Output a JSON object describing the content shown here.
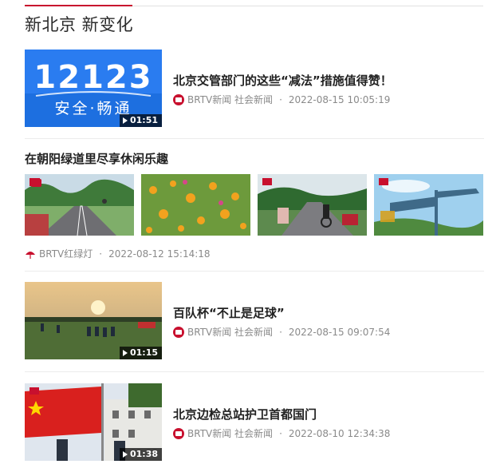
{
  "section": {
    "title": "新北京 新变化"
  },
  "items": [
    {
      "title": "北京交管部门的这些“减法”措施值得赞！",
      "source": "BRTV新闻 社会新闻",
      "date": "2022-08-15 10:05:19",
      "duration": "01:51",
      "thumb_text": "12123",
      "thumb_subtext": "安全·畅通"
    },
    {
      "title": "在朝阳绿道里尽享休闲乐趣",
      "source": "BRTV红绿灯",
      "date": "2022-08-12 15:14:18"
    },
    {
      "title": "百队杯“不止是足球”",
      "source": "BRTV新闻 社会新闻",
      "date": "2022-08-15 09:07:54",
      "duration": "01:15"
    },
    {
      "title": "北京边检总站护卫首都国门",
      "source": "BRTV新闻 社会新闻",
      "date": "2022-08-10 12:34:38",
      "duration": "01:38"
    }
  ],
  "meta_separator": "·",
  "colors": {
    "accent": "#c8102e",
    "thumb_blue": "#1d6fe0",
    "meta_gray": "#8a8a8a"
  },
  "icons": {
    "source_logo": "brtv-logo-icon",
    "play": "play-icon",
    "umbrella": "umbrella-icon"
  }
}
